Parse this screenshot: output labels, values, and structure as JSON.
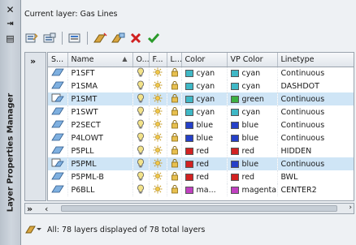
{
  "palette": {
    "title": "Layer Properties Manager",
    "close_glyph": "✕",
    "autohide_glyph": "⇥",
    "menu_glyph": "▤"
  },
  "header": {
    "current_layer": "Current layer: Gas Lines"
  },
  "toolbar": {
    "buttons": [
      "new-property-filter",
      "new-group-filter",
      "layer-states-manager",
      "new-layer",
      "new-layer-vp-frozen",
      "delete-layer",
      "set-current"
    ]
  },
  "filter_panel": {
    "collapse_glyph": "»"
  },
  "table": {
    "columns": [
      "S...",
      "Name",
      "O...",
      "F...",
      "L...",
      "Color",
      "VP Color",
      "Linetype"
    ],
    "sort_indicator": "▲",
    "rows": [
      {
        "status": "layer",
        "name": "P1SFT",
        "color": "cyan",
        "color_hex": "#3fb8c6",
        "vp_color": "cyan",
        "vp_hex": "#3fb8c6",
        "linetype": "Continuous",
        "selected": false
      },
      {
        "status": "layer",
        "name": "P1SMA",
        "color": "cyan",
        "color_hex": "#3fb8c6",
        "vp_color": "cyan",
        "vp_hex": "#3fb8c6",
        "linetype": "DASHDOT",
        "selected": false
      },
      {
        "status": "vp-override",
        "name": "P1SMT",
        "color": "cyan",
        "color_hex": "#3fb8c6",
        "vp_color": "green",
        "vp_hex": "#3cb043",
        "linetype": "Continuous",
        "selected": true
      },
      {
        "status": "layer",
        "name": "P1SWT",
        "color": "cyan",
        "color_hex": "#3fb8c6",
        "vp_color": "cyan",
        "vp_hex": "#3fb8c6",
        "linetype": "Continuous",
        "selected": false
      },
      {
        "status": "layer",
        "name": "P2SECT",
        "color": "blue",
        "color_hex": "#2540c8",
        "vp_color": "blue",
        "vp_hex": "#2540c8",
        "linetype": "Continuous",
        "selected": false
      },
      {
        "status": "layer",
        "name": "P4LOWT",
        "color": "blue",
        "color_hex": "#2540c8",
        "vp_color": "blue",
        "vp_hex": "#2540c8",
        "linetype": "Continuous",
        "selected": false
      },
      {
        "status": "layer",
        "name": "P5PLL",
        "color": "red",
        "color_hex": "#d22222",
        "vp_color": "red",
        "vp_hex": "#d22222",
        "linetype": "HIDDEN",
        "selected": false
      },
      {
        "status": "vp-override",
        "name": "P5PML",
        "color": "red",
        "color_hex": "#d22222",
        "vp_color": "blue",
        "vp_hex": "#2540c8",
        "linetype": "Continuous",
        "selected": true
      },
      {
        "status": "layer",
        "name": "P5PML-B",
        "color": "red",
        "color_hex": "#d22222",
        "vp_color": "red",
        "vp_hex": "#d22222",
        "linetype": "BWL",
        "selected": false
      },
      {
        "status": "layer",
        "name": "P6BLL",
        "color": "ma...",
        "color_hex": "#c040c0",
        "vp_color": "magenta",
        "vp_hex": "#c040c0",
        "linetype": "CENTER2",
        "selected": false
      }
    ]
  },
  "scroll": {
    "left_glyph": "»",
    "prev_glyph": "‹",
    "next_glyph": "›"
  },
  "status": {
    "text": "All: 78 layers displayed of 78 total layers"
  },
  "colors": {
    "selection": "#cfe5f6",
    "accent": "#2f78c8"
  }
}
